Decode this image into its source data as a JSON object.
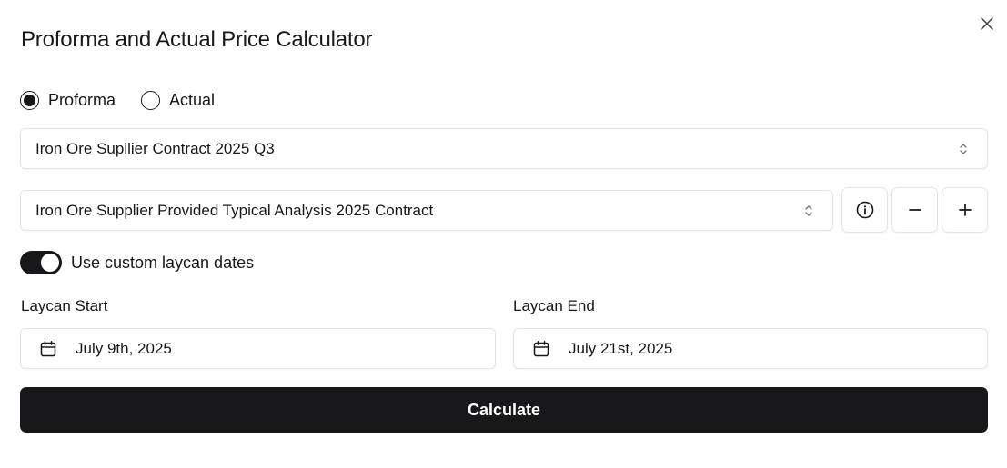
{
  "dialog": {
    "title": "Proforma and Actual Price Calculator"
  },
  "price_type": {
    "options": [
      {
        "label": "Proforma",
        "selected": true
      },
      {
        "label": "Actual",
        "selected": false
      }
    ]
  },
  "contract_select": {
    "value": "Iron Ore Supllier Contract 2025 Q3"
  },
  "analysis_select": {
    "value": "Iron Ore Supplier Provided Typical Analysis 2025 Contract"
  },
  "icons": {
    "close": "close-icon",
    "info": "info-icon",
    "minus": "minus-icon",
    "plus": "plus-icon",
    "chevron": "chevron-up-down-icon",
    "calendar": "calendar-icon"
  },
  "custom_laycan": {
    "label": "Use custom laycan dates",
    "enabled": true
  },
  "laycan_start": {
    "label": "Laycan Start",
    "value": "July 9th, 2025"
  },
  "laycan_end": {
    "label": "Laycan End",
    "value": "July 21st, 2025"
  },
  "actions": {
    "calculate_label": "Calculate"
  },
  "colors": {
    "primary": "#18181b",
    "border": "#e4e4e7",
    "background": "#ffffff"
  }
}
